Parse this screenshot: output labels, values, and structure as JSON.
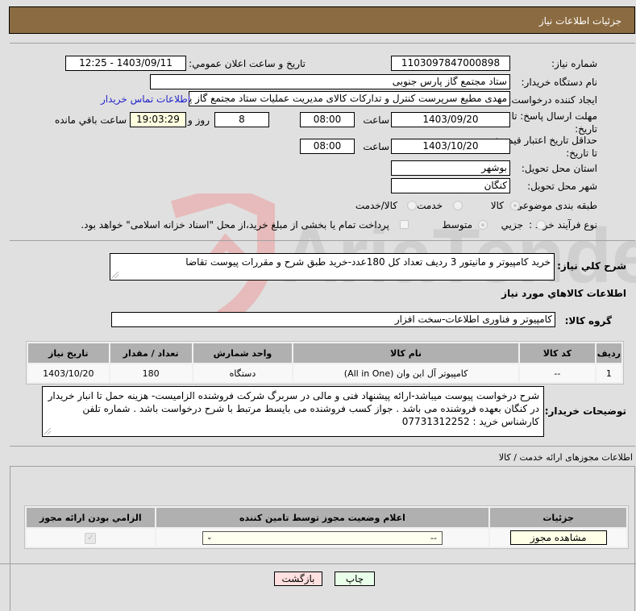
{
  "header": {
    "title": "جزئیات اطلاعات نیاز"
  },
  "form": {
    "need_number_label": "شماره نیاز:",
    "need_number": "1103097847000898",
    "announce_label": "تاریخ و ساعت اعلان عمومي:",
    "announce_value": "1403/09/11 - 12:25",
    "buyer_org_label": "نام دستگاه خریدار:",
    "buyer_org": "ستاد مجتمع گاز پارس جنوبی",
    "creator_label": "ایجاد کننده درخواست:",
    "creator": "مهدی مطیع سرپرست کنترل و تدارکات کالای مدیریت عملیات ستاد مجتمع گاز پا",
    "contact_link": "اطلاعات تماس خریدار",
    "deadline_label": "مهلت ارسال پاسخ: تا تاریخ:",
    "deadline_date": "1403/09/20",
    "time_label": "ساعت",
    "deadline_time": "08:00",
    "days_left": "8",
    "days_label": "روز و",
    "time_left": "19:03:29",
    "time_left_label": "ساعت باقي مانده",
    "validity_label": "حداقل تاریخ اعتبار قیمت: تا تاریخ:",
    "validity_date": "1403/10/20",
    "validity_time": "08:00",
    "province_label": "استان محل تحویل:",
    "province": "بوشهر",
    "city_label": "شهر محل تحویل:",
    "city": "کنگان",
    "category_label": "طبقه بندی موضوعی:",
    "category_options": [
      "کالا",
      "خدمت",
      "کالا/خدمت"
    ],
    "category_selected": "کالا",
    "process_label": "نوع فرآیند خرید :",
    "process_options": [
      "جزیي",
      "متوسط"
    ],
    "process_selected": "متوسط",
    "treasury_text": "پرداخت تمام یا بخشی از مبلغ خرید،از محل \"اسناد خزانه اسلامی\" خواهد بود.",
    "treasury_checked": false
  },
  "description": {
    "label": "شرح کلي نياز:",
    "value": "خرید کامپیوتر و مانیتور 3 ردیف تعداد کل 180عدد-خرید طبق شرح و مقررات پیوست تقاضا"
  },
  "goods": {
    "section_title": "اطلاعات کالاهاي مورد نياز",
    "group_label": "گروه کالا:",
    "group_value": "کامپیوتر و فناوری اطلاعات-سخت افزار",
    "columns": [
      "ردیف",
      "کد کالا",
      "نام کالا",
      "واحد شمارش",
      "تعداد / مقدار",
      "تاریخ نیاز"
    ],
    "rows": [
      [
        "1",
        "--",
        "کامپیوتر آل این وان (All in One)",
        "دستگاه",
        "180",
        "1403/10/20"
      ]
    ]
  },
  "buyer_notes": {
    "label": "توضیحات خریدار:",
    "value": "شرح درخواست پیوست میباشد-ارائه پیشنهاد فنی و مالی در سربرگ شرکت فروشنده الزامیست- هزینه حمل  تا انبار خریدار در کنگان بعهده فروشنده می باشد . جواز کسب فروشنده می بایسط مرتبط با شرح درخواست باشد . شماره تلفن کارشناس خرید : 07731312252"
  },
  "permits": {
    "section_title": "اطلاعات مجوزهای ارائه خدمت / کالا",
    "columns": [
      "الزامي بودن ارائه مجوز",
      "اعلام وضعیت مجوز توسط تامین کننده",
      "جزئیات"
    ],
    "row": {
      "required": true,
      "status_value": "--",
      "details_button": "مشاهده مجوز"
    }
  },
  "actions": {
    "print": "چاپ",
    "back": "بازگشت"
  },
  "watermark": {
    "text": "AriaTender.neT"
  }
}
